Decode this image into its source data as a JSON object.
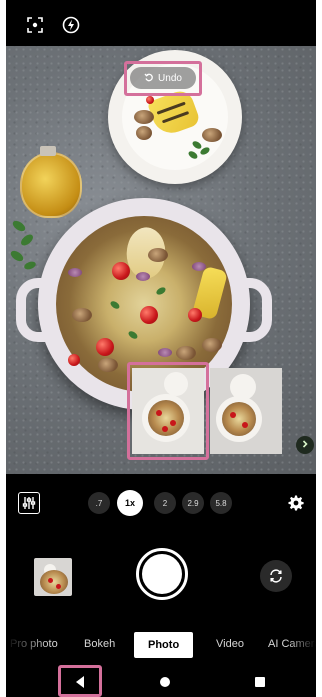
{
  "status_bar": {
    "icons": [
      "focus-frame-icon",
      "flash-auto-icon"
    ]
  },
  "viewfinder": {
    "restore_pill": {
      "icon": "rotate-left-icon",
      "label": "Undo"
    }
  },
  "zoom": {
    "options": [
      ".7",
      "1x",
      "2",
      "2.9",
      "5.8"
    ],
    "active": "1x"
  },
  "controls": {
    "settings_icon": "gear-icon",
    "adjust_icon": "sliders-icon",
    "switch_camera_icon": "rotate-camera-icon"
  },
  "modes": {
    "items": [
      "Pro photo",
      "Bokeh",
      "Photo",
      "Video",
      "AI Camera"
    ],
    "active": "Photo"
  },
  "colors": {
    "highlight": "#d4709b",
    "next_button": "#1f2a1f"
  },
  "navbar": {
    "icons": [
      "back-icon",
      "home-icon",
      "recents-icon"
    ]
  }
}
